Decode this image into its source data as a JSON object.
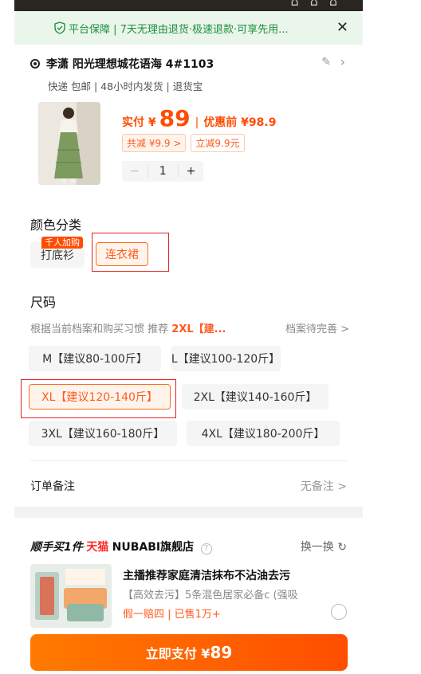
{
  "guarantee": {
    "text": "平台保障 | 7天无理由退货·极速退款·可享先用...",
    "close_icon": "close-icon"
  },
  "address": {
    "line": "李潇 阳光理想城花语海 4#1103",
    "sub": "快递 包邮 | 48小时内发货 | 退货宝"
  },
  "product": {
    "price_label": "实付 ¥",
    "price": "89",
    "separator": "|",
    "before_price": "优惠前 ¥98.9",
    "discount_total": "共减 ¥9.9 >",
    "instant_discount": "立减9.9元",
    "quantity": "1",
    "minus": "−",
    "plus": "+"
  },
  "color": {
    "title": "颜色分类",
    "badge": "千人加购",
    "options": [
      "打底衫",
      "连衣裙"
    ],
    "selected": "连衣裙"
  },
  "size": {
    "title": "尺码",
    "recommend_prefix": "根据当前档案和购买习惯 推荐",
    "recommend_value": "2XL【建...",
    "profile_link": "档案待完善 >",
    "options": [
      "M【建议80-100斤】",
      "L【建议100-120斤】",
      "XL【建议120-140斤】",
      "2XL【建议140-160斤】",
      "3XL【建议160-180斤】",
      "4XL【建议180-200斤】"
    ],
    "selected": "XL【建议120-140斤】"
  },
  "remark": {
    "label": "订单备注",
    "value": "无备注 >"
  },
  "recommendation": {
    "header_prefix": "顺手买1件",
    "header_dot": "·",
    "tmall": "天猫",
    "store": "NUBABI旗舰店",
    "help": "?",
    "swap": "换一换",
    "item_title": "主播推荐家庭清洁抹布不沾油去污",
    "item_sub": "【高效去污】5条混色居家必备c (强吸",
    "item_tags": "假一赔四 | 已售1万+"
  },
  "pay": {
    "label": "立即支付 ¥",
    "amount": "89"
  },
  "colors": {
    "accent": "#ff5a1f",
    "green": "#1f8f3c",
    "highlight": "#e32222"
  }
}
